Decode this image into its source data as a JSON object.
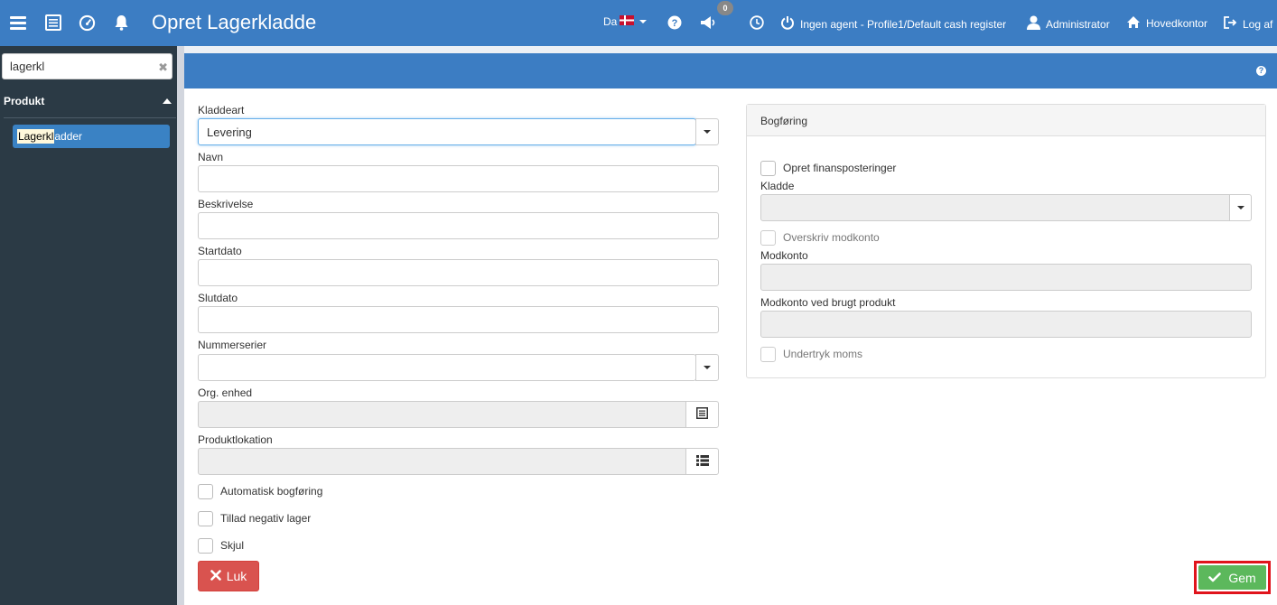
{
  "header": {
    "title": "Opret Lagerkladde",
    "language": "Da",
    "notification_count": "0",
    "agent_status": "Ingen agent - Profile1/Default cash register",
    "user": "Administrator",
    "branch": "Hovedkontor",
    "logout": "Log af"
  },
  "sidebar": {
    "search_value": "lagerkl",
    "section": "Produkt",
    "item_highlight": "Lagerkl",
    "item_rest": "adder"
  },
  "form": {
    "kladdeart_label": "Kladdeart",
    "kladdeart_value": "Levering",
    "navn_label": "Navn",
    "beskrivelse_label": "Beskrivelse",
    "startdato_label": "Startdato",
    "slutdato_label": "Slutdato",
    "nummerserier_label": "Nummerserier",
    "orgenhed_label": "Org. enhed",
    "produktlokation_label": "Produktlokation",
    "auto_bogforing_label": "Automatisk bogføring",
    "negativ_lager_label": "Tillad negativ lager",
    "skjul_label": "Skjul"
  },
  "bogforing": {
    "title": "Bogføring",
    "opret_label": "Opret finansposteringer",
    "kladde_label": "Kladde",
    "overskriv_label": "Overskriv modkonto",
    "modkonto_label": "Modkonto",
    "modkonto_brugt_label": "Modkonto ved brugt produkt",
    "undertryk_label": "Undertryk moms"
  },
  "buttons": {
    "close_label": "Luk",
    "save_label": "Gem"
  },
  "colors": {
    "primary": "#3c7dc3",
    "sidebar": "#2b3a45",
    "danger": "#d9534f",
    "success": "#5cb85c",
    "highlight_frame": "#e0141c"
  }
}
